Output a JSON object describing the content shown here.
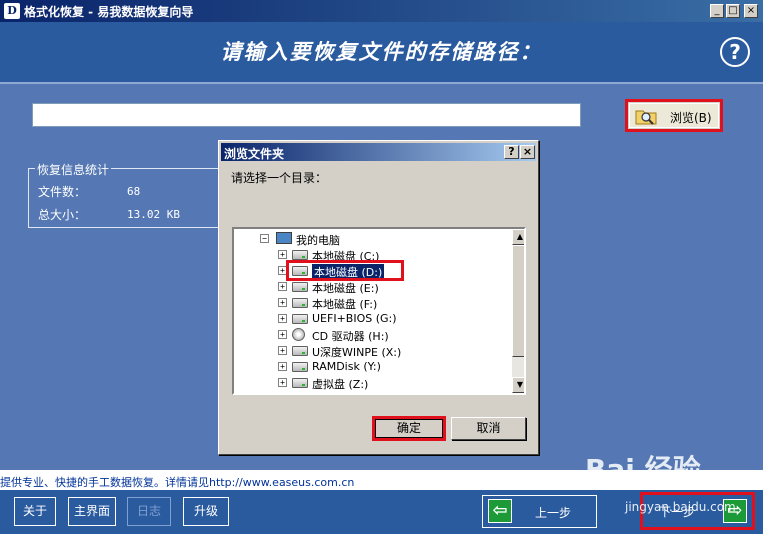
{
  "window": {
    "title": "格式化恢复 - 易我数据恢复向导",
    "icon_letter": "D",
    "controls": {
      "minimize": "_",
      "maximize": "□",
      "close": "×"
    }
  },
  "header": {
    "title": "请输入要恢复文件的存储路径：",
    "help_label": "?"
  },
  "path_input": {
    "value": "",
    "placeholder": ""
  },
  "browse_button": {
    "label": "浏览(B)"
  },
  "stats": {
    "title": "恢复信息统计",
    "file_count_label": "文件数：",
    "file_count_value": "68",
    "total_size_label": "总大小：",
    "total_size_value": "13.02 KB"
  },
  "dialog": {
    "title": "浏览文件夹",
    "help_label": "?",
    "close_label": "×",
    "prompt": "请选择一个目录：",
    "tree": {
      "root": "我的电脑",
      "items": [
        {
          "label": "本地磁盘  (C:)",
          "icon": "hard-drive",
          "selected": false
        },
        {
          "label": "本地磁盘  (D:)",
          "icon": "hard-drive",
          "selected": true
        },
        {
          "label": "本地磁盘  (E:)",
          "icon": "hard-drive",
          "selected": false
        },
        {
          "label": "本地磁盘  (F:)",
          "icon": "hard-drive",
          "selected": false
        },
        {
          "label": "UEFI+BIOS  (G:)",
          "icon": "removable-drive",
          "selected": false
        },
        {
          "label": "CD 驱动器  (H:)",
          "icon": "cd-drive",
          "selected": false
        },
        {
          "label": "U深度WINPE  (X:)",
          "icon": "removable-drive",
          "selected": false
        },
        {
          "label": "RAMDisk  (Y:)",
          "icon": "hard-drive",
          "selected": false
        },
        {
          "label": "虚拟盘  (Z:)",
          "icon": "hard-drive",
          "selected": false
        }
      ]
    },
    "ok_label": "确定",
    "cancel_label": "取消"
  },
  "status_text": "提供专业、快捷的手工数据恢复。详情请见http://www.easeus.com.cn",
  "bottom_buttons": {
    "about": "关于",
    "main": "主界面",
    "log": "日志",
    "upgrade": "升级",
    "prev": "上一步",
    "next": "下一步"
  },
  "watermark": {
    "text": "Bai 经验",
    "sub": "jingyan.baidu.com"
  },
  "colors": {
    "background": "#5578b4",
    "header": "#2a5b9f",
    "highlight_box": "#e0101c",
    "arrow": "#1c9a38"
  }
}
